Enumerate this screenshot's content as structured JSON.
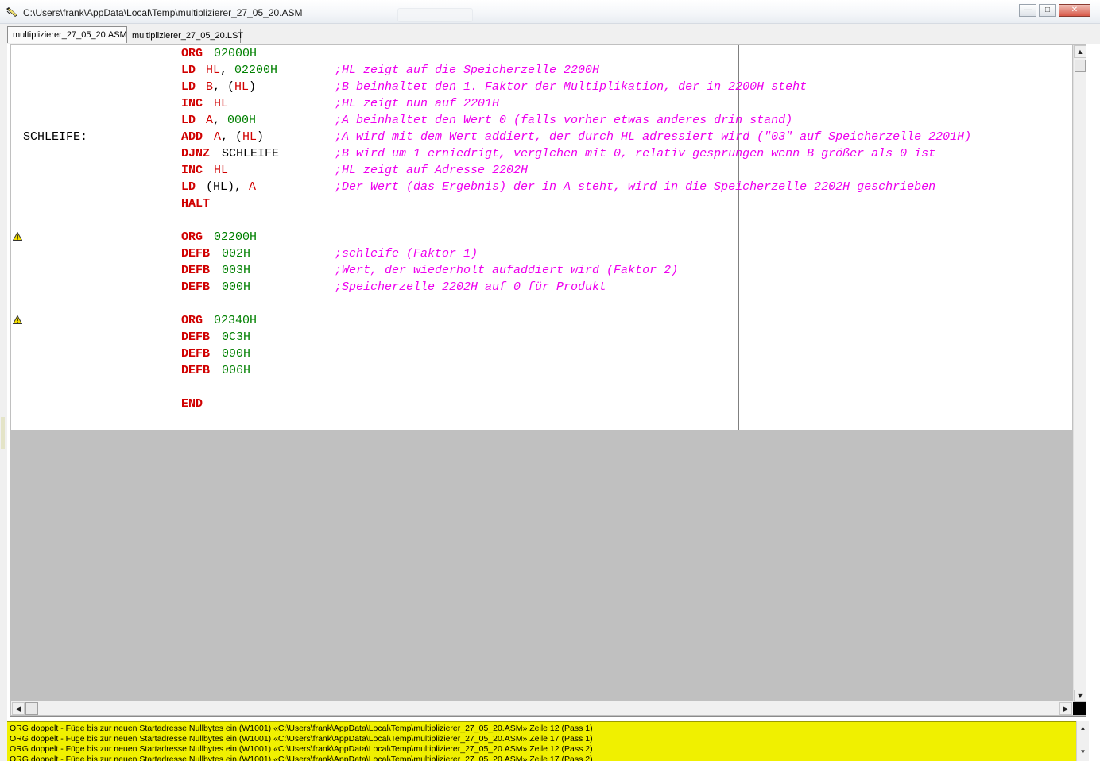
{
  "window": {
    "title": "C:\\Users\\frank\\AppData\\Local\\Temp\\multiplizierer_27_05_20.ASM",
    "min_glyph": "—",
    "max_glyph": "□",
    "close_glyph": "✕"
  },
  "tabs": [
    {
      "label": "multiplizierer_27_05_20.ASM",
      "active": true
    },
    {
      "label": "multiplizierer_27_05_20.LST",
      "active": false
    }
  ],
  "code": {
    "lines": [
      {
        "label": "",
        "mnemonic": "ORG",
        "operands": [
          {
            "t": "02000H",
            "k": "num"
          }
        ],
        "comment": "",
        "warning": false
      },
      {
        "label": "",
        "mnemonic": "LD",
        "operands": [
          {
            "t": "HL",
            "k": "reg"
          },
          {
            "t": ", ",
            "k": "plain"
          },
          {
            "t": "02200H",
            "k": "num"
          }
        ],
        "comment": ";HL zeigt auf die Speicherzelle 2200H",
        "warning": false
      },
      {
        "label": "",
        "mnemonic": "LD",
        "operands": [
          {
            "t": "B",
            "k": "reg"
          },
          {
            "t": ", (",
            "k": "plain"
          },
          {
            "t": "HL",
            "k": "reg"
          },
          {
            "t": ")",
            "k": "plain"
          }
        ],
        "comment": ";B beinhaltet den 1. Faktor der Multiplikation, der in 2200H steht",
        "warning": false
      },
      {
        "label": "",
        "mnemonic": "INC",
        "operands": [
          {
            "t": "HL",
            "k": "reg"
          }
        ],
        "comment": ";HL zeigt nun auf 2201H",
        "warning": false
      },
      {
        "label": "",
        "mnemonic": "LD",
        "operands": [
          {
            "t": "A",
            "k": "reg"
          },
          {
            "t": ", ",
            "k": "plain"
          },
          {
            "t": "000H",
            "k": "num"
          }
        ],
        "comment": ";A beinhaltet den Wert 0 (falls vorher etwas anderes drin stand)",
        "warning": false
      },
      {
        "label": "SCHLEIFE:",
        "mnemonic": "ADD",
        "operands": [
          {
            "t": "A",
            "k": "reg"
          },
          {
            "t": ", (",
            "k": "plain"
          },
          {
            "t": "HL",
            "k": "reg"
          },
          {
            "t": ")",
            "k": "plain"
          }
        ],
        "comment": ";A wird mit dem Wert addiert, der durch HL adressiert wird (\"03\" auf Speicherzelle 2201H)",
        "warning": false
      },
      {
        "label": "",
        "mnemonic": "DJNZ",
        "operands": [
          {
            "t": "SCHLEIFE",
            "k": "plain"
          }
        ],
        "comment": ";B wird um 1 erniedrigt, verglchen mit 0, relativ gesprungen wenn B größer als 0 ist",
        "warning": false
      },
      {
        "label": "",
        "mnemonic": "INC",
        "operands": [
          {
            "t": "HL",
            "k": "reg"
          }
        ],
        "comment": ";HL zeigt auf Adresse 2202H",
        "warning": false
      },
      {
        "label": "",
        "mnemonic": "LD",
        "operands": [
          {
            "t": "(HL), ",
            "k": "plain"
          },
          {
            "t": "A",
            "k": "reg"
          }
        ],
        "comment": ";Der Wert (das Ergebnis) der in A steht, wird in die Speicherzelle 2202H geschrieben",
        "warning": false
      },
      {
        "label": "",
        "mnemonic": "HALT",
        "operands": [],
        "comment": "",
        "warning": false
      },
      {
        "label": "",
        "mnemonic": "",
        "operands": [],
        "comment": "",
        "warning": false
      },
      {
        "label": "",
        "mnemonic": "ORG",
        "operands": [
          {
            "t": "02200H",
            "k": "num"
          }
        ],
        "comment": "",
        "warning": true
      },
      {
        "label": "",
        "mnemonic": "DEFB",
        "operands": [
          {
            "t": "002H",
            "k": "num"
          }
        ],
        "comment": ";schleife (Faktor 1)",
        "warning": false
      },
      {
        "label": "",
        "mnemonic": "DEFB",
        "operands": [
          {
            "t": "003H",
            "k": "num"
          }
        ],
        "comment": ";Wert, der wiederholt aufaddiert wird (Faktor 2)",
        "warning": false
      },
      {
        "label": "",
        "mnemonic": "DEFB",
        "operands": [
          {
            "t": "000H",
            "k": "num"
          }
        ],
        "comment": ";Speicherzelle 2202H auf 0 für Produkt",
        "warning": false
      },
      {
        "label": "",
        "mnemonic": "",
        "operands": [],
        "comment": "",
        "warning": false
      },
      {
        "label": "",
        "mnemonic": "ORG",
        "operands": [
          {
            "t": "02340H",
            "k": "num"
          }
        ],
        "comment": "",
        "warning": true
      },
      {
        "label": "",
        "mnemonic": "DEFB",
        "operands": [
          {
            "t": "0C3H",
            "k": "num"
          }
        ],
        "comment": "",
        "warning": false
      },
      {
        "label": "",
        "mnemonic": "DEFB",
        "operands": [
          {
            "t": "090H",
            "k": "num"
          }
        ],
        "comment": "",
        "warning": false
      },
      {
        "label": "",
        "mnemonic": "DEFB",
        "operands": [
          {
            "t": "006H",
            "k": "num"
          }
        ],
        "comment": "",
        "warning": false
      },
      {
        "label": "",
        "mnemonic": "",
        "operands": [],
        "comment": "",
        "warning": false
      },
      {
        "label": "",
        "mnemonic": "END",
        "operands": [],
        "comment": "",
        "warning": false
      }
    ]
  },
  "messages": [
    "ORG doppelt - Füge bis zur neuen Startadresse Nullbytes ein (W1001) «C:\\Users\\frank\\AppData\\Local\\Temp\\multiplizierer_27_05_20.ASM» Zeile 12 (Pass 1)",
    "ORG doppelt - Füge bis zur neuen Startadresse Nullbytes ein (W1001) «C:\\Users\\frank\\AppData\\Local\\Temp\\multiplizierer_27_05_20.ASM» Zeile 17 (Pass 1)",
    "ORG doppelt - Füge bis zur neuen Startadresse Nullbytes ein (W1001) «C:\\Users\\frank\\AppData\\Local\\Temp\\multiplizierer_27_05_20.ASM» Zeile 12 (Pass 2)",
    "ORG doppelt - Füge bis zur neuen Startadresse Nullbytes ein (W1001) «C:\\Users\\frank\\AppData\\Local\\Temp\\multiplizierer_27_05_20.ASM» Zeile 17 (Pass 2)"
  ],
  "colors": {
    "mnemonic": "#d00000",
    "register": "#d00000",
    "number": "#008000",
    "comment": "#ee00ee",
    "message_background": "#f0f000",
    "editor_empty": "#c0c0c0"
  },
  "icons": {
    "app": "ruler-pencil-icon",
    "warning": "warning-triangle-icon",
    "scroll_up": "▲",
    "scroll_down": "▼",
    "scroll_left": "◀",
    "scroll_right": "▶"
  }
}
